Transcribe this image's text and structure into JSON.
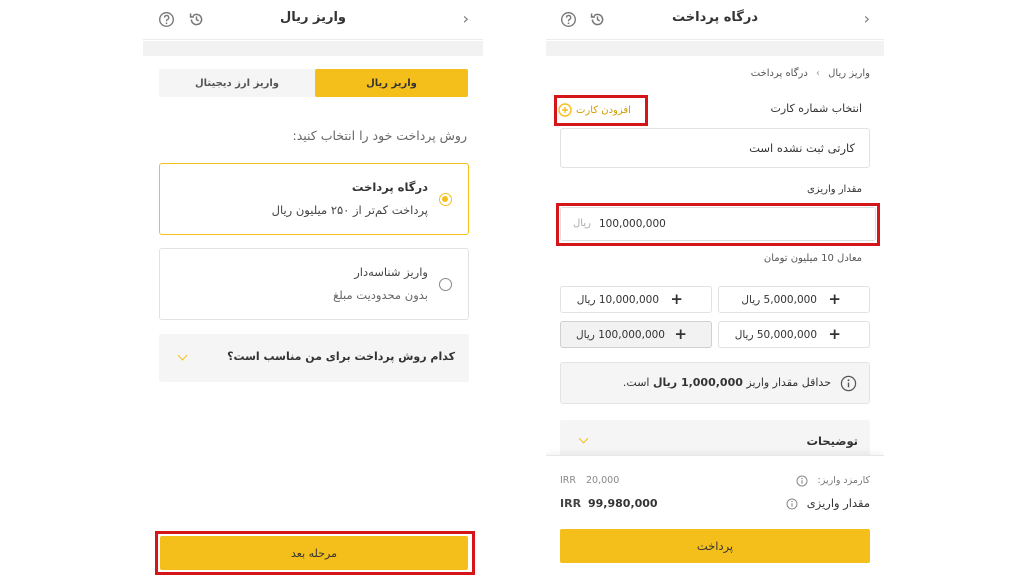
{
  "left": {
    "title": "واریز ریال",
    "tabs": [
      {
        "label": "واریز ریال",
        "active": true
      },
      {
        "label": "واریز ارز دیجیتال",
        "active": false
      }
    ],
    "prompt": "روش پرداخت خود را انتخاب کنید:",
    "options": [
      {
        "title": "درگاه پرداخت",
        "subtitle": "پرداخت کم‌تر از ۲۵۰ میلیون ریال",
        "selected": true
      },
      {
        "title": "واریز شناسه‌دار",
        "subtitle": "بدون محدودیت مبلغ",
        "selected": false
      }
    ],
    "faq": "کدام روش پرداخت برای من مناسب است؟",
    "next_button": "مرحله بعد"
  },
  "right": {
    "title": "درگاه پرداخت",
    "breadcrumb": {
      "root": "واریز ریال",
      "separator": "›",
      "current": "درگاه پرداخت"
    },
    "card_label": "انتخاب شماره کارت",
    "add_card": "افزودن کارت",
    "no_card": "کارتی ثبت نشده است",
    "amount_label": "مقدار واریزی",
    "amount_value": "100,000,000",
    "amount_unit": "ریال",
    "equivalent": "معادل 10 میلیون تومان",
    "quick_amounts": [
      "5,000,000 ریال",
      "10,000,000 ریال",
      "50,000,000 ریال",
      "100,000,000 ریال"
    ],
    "min_note_prefix": "حداقل مقدار واریز",
    "min_note_amount": "1,000,000 ریال",
    "min_note_suffix": "است.",
    "desc_title": "توضیحات",
    "fee_label": "کارمزد واریز:",
    "fee_value": "20,000",
    "fee_currency": "IRR",
    "deposit_label": "مقدار واریزی",
    "deposit_value": "99,980,000",
    "deposit_currency": "IRR",
    "pay_button": "پرداخت"
  },
  "colors": {
    "accent": "#f5bf1b",
    "highlight": "#d4151a"
  }
}
